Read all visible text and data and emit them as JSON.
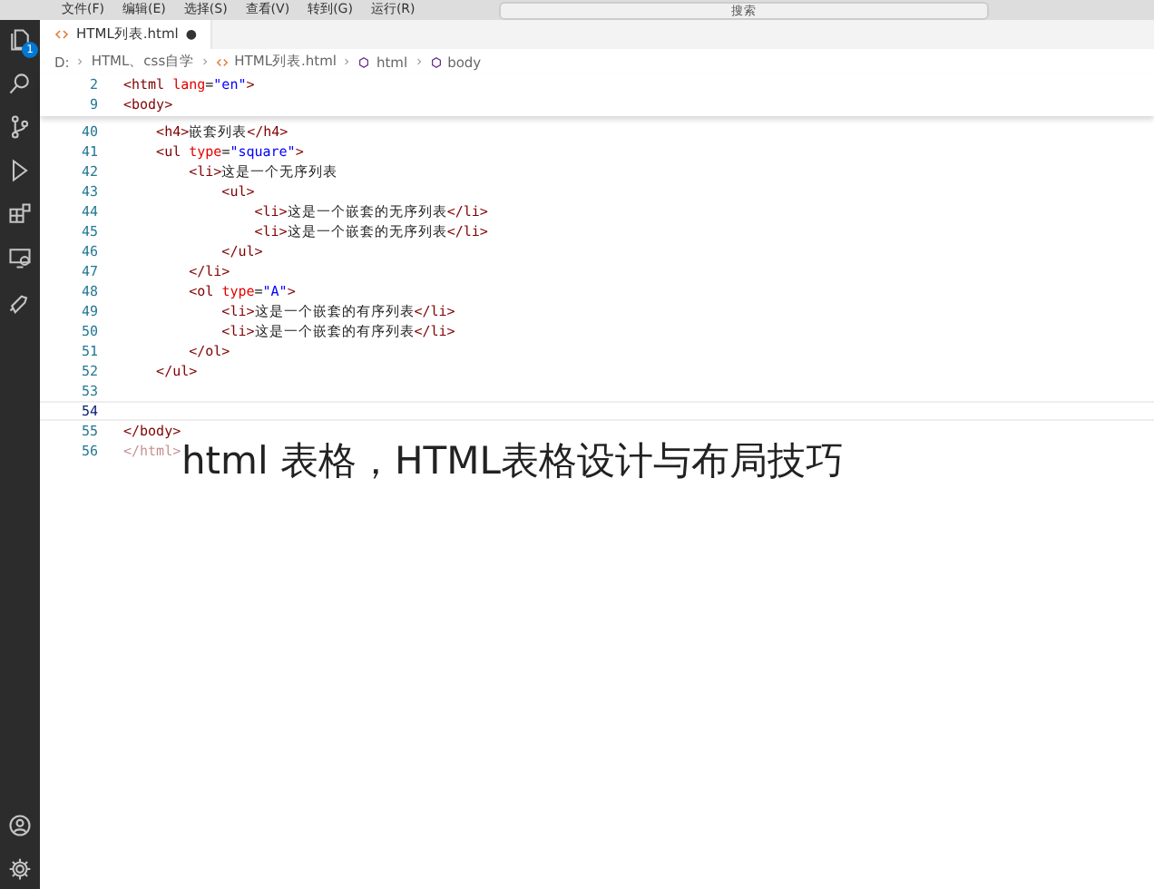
{
  "menu_bar": {
    "items": [
      "文件(F)",
      "编辑(E)",
      "选择(S)",
      "查看(V)",
      "转到(G)",
      "运行(R)"
    ],
    "search": {
      "placeholder": "搜索"
    }
  },
  "activity_bar": {
    "explorer_badge": "1"
  },
  "tabs": [
    {
      "label": "HTML列表.html",
      "modified_marker": "●",
      "selected": true
    }
  ],
  "breadcrumb": [
    "D:",
    "HTML、css自学",
    "HTML列表.html",
    "html",
    "body"
  ],
  "sticky_lines": [
    {
      "number": "2",
      "tokens": [
        {
          "kind": "tag",
          "text": "<html "
        },
        {
          "kind": "attr",
          "text": "lang"
        },
        {
          "kind": "text",
          "text": "="
        },
        {
          "kind": "value",
          "text": "\"en\""
        },
        {
          "kind": "tag",
          "text": ">"
        }
      ]
    },
    {
      "number": "9",
      "tokens": [
        {
          "kind": "tag",
          "text": "<body>"
        }
      ]
    }
  ],
  "lines": [
    {
      "number": "40",
      "current": false,
      "tokens": [
        {
          "kind": "tag",
          "text": "    <h4>"
        },
        {
          "kind": "text",
          "text": "嵌套列表"
        },
        {
          "kind": "tag",
          "text": "</h4>"
        }
      ]
    },
    {
      "number": "41",
      "current": false,
      "tokens": [
        {
          "kind": "tag",
          "text": "    <ul "
        },
        {
          "kind": "attr",
          "text": "type"
        },
        {
          "kind": "text",
          "text": "="
        },
        {
          "kind": "value",
          "text": "\"square\""
        },
        {
          "kind": "tag",
          "text": ">"
        }
      ]
    },
    {
      "number": "42",
      "current": false,
      "tokens": [
        {
          "kind": "tag",
          "text": "        <li>"
        },
        {
          "kind": "text",
          "text": "这是一个无序列表"
        }
      ]
    },
    {
      "number": "43",
      "current": false,
      "tokens": [
        {
          "kind": "tag",
          "text": "            <ul>"
        }
      ]
    },
    {
      "number": "44",
      "current": false,
      "tokens": [
        {
          "kind": "tag",
          "text": "                <li>"
        },
        {
          "kind": "text",
          "text": "这是一个嵌套的无序列表"
        },
        {
          "kind": "tag",
          "text": "</li>"
        }
      ]
    },
    {
      "number": "45",
      "current": false,
      "tokens": [
        {
          "kind": "tag",
          "text": "                <li>"
        },
        {
          "kind": "text",
          "text": "这是一个嵌套的无序列表"
        },
        {
          "kind": "tag",
          "text": "</li>"
        }
      ]
    },
    {
      "number": "46",
      "current": false,
      "tokens": [
        {
          "kind": "tag",
          "text": "            </ul>"
        }
      ]
    },
    {
      "number": "47",
      "current": false,
      "tokens": [
        {
          "kind": "tag",
          "text": "        </li>"
        }
      ]
    },
    {
      "number": "48",
      "current": false,
      "tokens": [
        {
          "kind": "tag",
          "text": "        <ol "
        },
        {
          "kind": "attr",
          "text": "type"
        },
        {
          "kind": "text",
          "text": "="
        },
        {
          "kind": "value",
          "text": "\"A\""
        },
        {
          "kind": "tag",
          "text": ">"
        }
      ]
    },
    {
      "number": "49",
      "current": false,
      "tokens": [
        {
          "kind": "tag",
          "text": "            <li>"
        },
        {
          "kind": "text",
          "text": "这是一个嵌套的有序列表"
        },
        {
          "kind": "tag",
          "text": "</li>"
        }
      ]
    },
    {
      "number": "50",
      "current": false,
      "tokens": [
        {
          "kind": "tag",
          "text": "            <li>"
        },
        {
          "kind": "text",
          "text": "这是一个嵌套的有序列表"
        },
        {
          "kind": "tag",
          "text": "</li>"
        }
      ]
    },
    {
      "number": "51",
      "current": false,
      "tokens": [
        {
          "kind": "tag",
          "text": "        </ol>"
        }
      ]
    },
    {
      "number": "52",
      "current": false,
      "tokens": [
        {
          "kind": "tag",
          "text": "    </ul>"
        }
      ]
    },
    {
      "number": "53",
      "current": false
    },
    {
      "number": "54",
      "current": true
    },
    {
      "number": "55",
      "current": false,
      "tokens": [
        {
          "kind": "tag",
          "text": "</body>"
        }
      ]
    },
    {
      "number": "56",
      "current": false,
      "faded": true,
      "tokens": [
        {
          "kind": "tag",
          "text": "</html>"
        }
      ]
    }
  ],
  "caption": "html 表格，HTML表格设计与布局技巧"
}
